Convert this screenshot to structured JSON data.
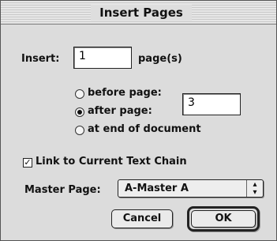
{
  "window": {
    "title": "Insert Pages"
  },
  "insert": {
    "label": "Insert:",
    "value": "1",
    "unit": "page(s)"
  },
  "position": {
    "options": [
      {
        "label": "before page:",
        "selected": false
      },
      {
        "label": "after page:",
        "selected": true
      },
      {
        "label": "at end of document",
        "selected": false
      }
    ],
    "page_value": "3"
  },
  "link": {
    "label": "Link to Current Text Chain",
    "checked": true
  },
  "master": {
    "label": "Master Page:",
    "value": "A-Master A"
  },
  "buttons": {
    "cancel": "Cancel",
    "ok": "OK"
  },
  "icons": {
    "checkbox": "checkmark-icon",
    "select": "updown-arrows-icon"
  }
}
